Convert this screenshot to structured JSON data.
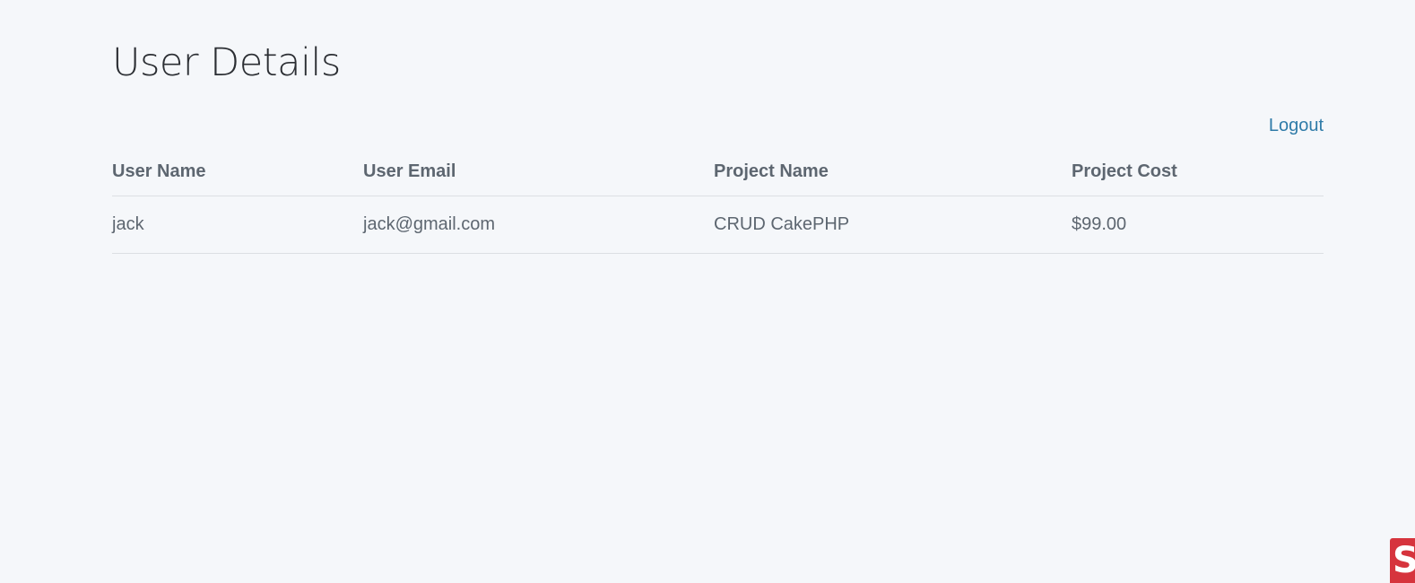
{
  "page": {
    "title": "User Details",
    "logout_label": "Logout"
  },
  "table": {
    "columns": [
      "User Name",
      "User Email",
      "Project Name",
      "Project Cost"
    ],
    "rows": [
      [
        "jack",
        "jack@gmail.com",
        "CRUD CakePHP",
        "$99.00"
      ]
    ]
  },
  "colors": {
    "background": "#f5f7fa",
    "link": "#2f7ba8",
    "text": "#5d6670",
    "title": "#2b2e33",
    "badge": "#d6343d"
  },
  "badge": {
    "icon": "extension-badge-icon",
    "glyph": "S"
  }
}
